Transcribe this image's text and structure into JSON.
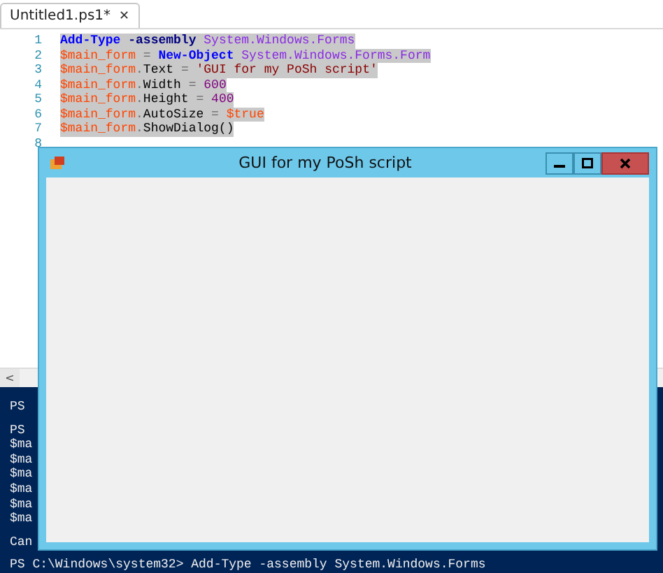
{
  "tab": {
    "label": "Untitled1.ps1*",
    "close": "✕",
    "selected": true
  },
  "editor": {
    "lines": [
      {
        "number": "1",
        "selected": true,
        "tokens": [
          {
            "t": "Add-Type",
            "kind": "cmdlet"
          },
          {
            "t": " -assembly ",
            "kind": "param"
          },
          {
            "t": "System.Windows.Forms",
            "kind": "type"
          }
        ]
      },
      {
        "number": "2",
        "selected": true,
        "tokens": [
          {
            "t": "$main_form",
            "kind": "variable"
          },
          {
            "t": " = ",
            "kind": "operator"
          },
          {
            "t": "New-Object ",
            "kind": "cmdlet"
          },
          {
            "t": "System.Windows.Forms.Form",
            "kind": "type"
          }
        ]
      },
      {
        "number": "3",
        "selected": true,
        "tokens": [
          {
            "t": "$main_form",
            "kind": "variable"
          },
          {
            "t": ".",
            "kind": "operator"
          },
          {
            "t": "Text ",
            "kind": "member"
          },
          {
            "t": "= ",
            "kind": "operator"
          },
          {
            "t": "'GUI for my PoSh script'",
            "kind": "string"
          }
        ]
      },
      {
        "number": "4",
        "selected": true,
        "tokens": [
          {
            "t": "$main_form",
            "kind": "variable"
          },
          {
            "t": ".",
            "kind": "operator"
          },
          {
            "t": "Width ",
            "kind": "member"
          },
          {
            "t": "= ",
            "kind": "operator"
          },
          {
            "t": "600",
            "kind": "number"
          }
        ]
      },
      {
        "number": "5",
        "selected": true,
        "tokens": [
          {
            "t": "$main_form",
            "kind": "variable"
          },
          {
            "t": ".",
            "kind": "operator"
          },
          {
            "t": "Height ",
            "kind": "member"
          },
          {
            "t": "= ",
            "kind": "operator"
          },
          {
            "t": "400",
            "kind": "number"
          }
        ]
      },
      {
        "number": "6",
        "selected": true,
        "tokens": [
          {
            "t": "$main_form",
            "kind": "variable"
          },
          {
            "t": ".",
            "kind": "operator"
          },
          {
            "t": "AutoSize ",
            "kind": "member"
          },
          {
            "t": "= ",
            "kind": "operator"
          },
          {
            "t": "$true",
            "kind": "variable"
          }
        ]
      },
      {
        "number": "7",
        "selected": true,
        "tokens": [
          {
            "t": "$main_form",
            "kind": "variable"
          },
          {
            "t": ".",
            "kind": "operator"
          },
          {
            "t": "ShowDialog()",
            "kind": "member"
          }
        ]
      },
      {
        "number": "8"
      }
    ]
  },
  "scrollbar": {
    "arrow": "<"
  },
  "console": {
    "blocks": [
      [
        "PS"
      ],
      [
        "PS",
        "$ma",
        "$ma",
        "$ma",
        "$ma",
        "$ma",
        "$ma"
      ],
      [
        "Can"
      ],
      [
        "PS C:\\Windows\\system32> Add-Type -assembly System.Windows.Forms"
      ]
    ]
  },
  "dialog": {
    "title": "GUI for my PoSh script"
  }
}
